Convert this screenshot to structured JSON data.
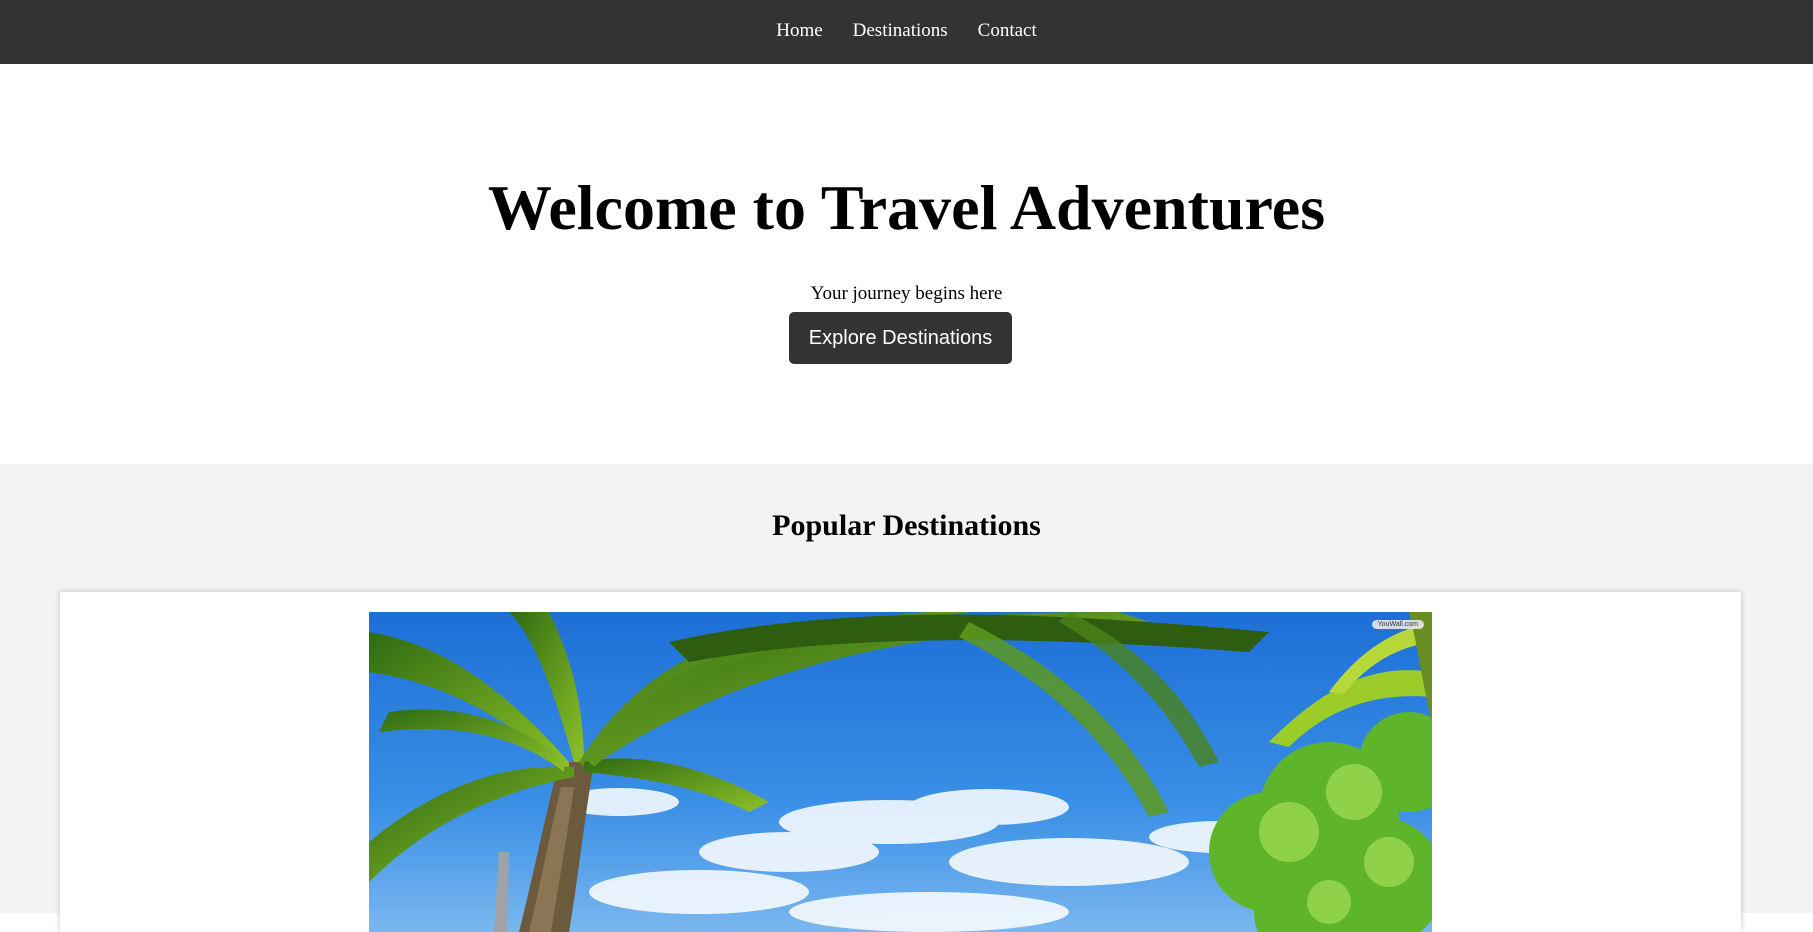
{
  "nav": {
    "items": [
      {
        "label": "Home"
      },
      {
        "label": "Destinations"
      },
      {
        "label": "Contact"
      }
    ]
  },
  "hero": {
    "title": "Welcome to Travel Adventures",
    "tagline": "Your journey begins here",
    "cta_label": "Explore Destinations"
  },
  "destinations": {
    "heading": "Popular Destinations",
    "cards": [
      {
        "image_icon": "tropical-beach-palm-photo",
        "watermark": "YouWall.com"
      }
    ]
  },
  "colors": {
    "nav_bg": "#333333",
    "button_bg": "#333333",
    "section_bg": "#f3f3f3",
    "text": "#000000",
    "nav_text": "#ffffff"
  }
}
